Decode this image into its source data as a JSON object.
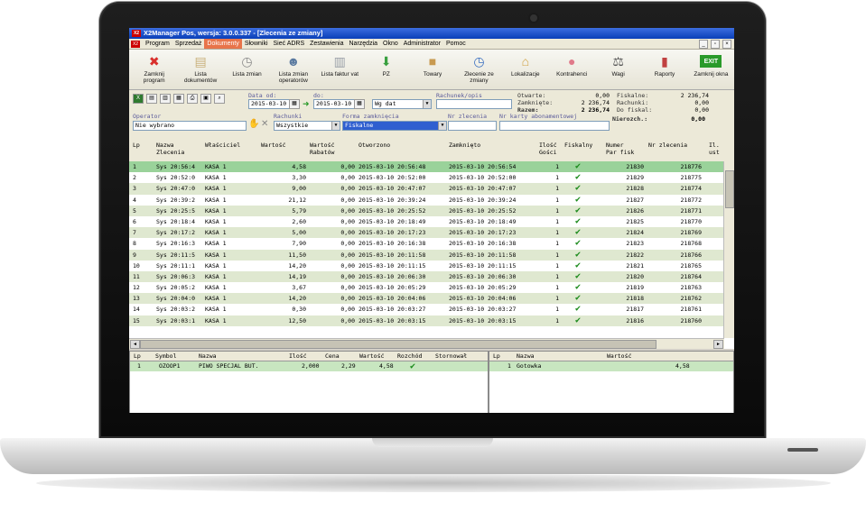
{
  "window": {
    "title": "X2Manager Pos, wersja: 3.0.0.337 - [Zlecenia ze zmiany]",
    "app_icon_text": "X2"
  },
  "menu": [
    "Program",
    "Sprzedaż",
    "Dokumenty",
    "Słowniki",
    "Sieć ADRS",
    "Zestawienia",
    "Narzędzia",
    "Okno",
    "Administrator",
    "Pomoc"
  ],
  "menu_active": "Dokumenty",
  "toolbar": [
    {
      "label": "Zamknij\nprogram",
      "icon": "close-icon",
      "color": "#d9302c"
    },
    {
      "label": "Lista\ndokumentów",
      "icon": "documents-icon",
      "color": "#c8b07a"
    },
    {
      "label": "Lista zmian",
      "icon": "clock-icon",
      "color": "#8a8a8a"
    },
    {
      "label": "Lista zmian\noperatorów",
      "icon": "users-icon",
      "color": "#5a7aa0"
    },
    {
      "label": "Lista faktur vat",
      "icon": "invoice-icon",
      "color": "#9aa0a8"
    },
    {
      "label": "PZ",
      "icon": "pz-icon",
      "color": "#3aa040"
    },
    {
      "label": "Towary",
      "icon": "box-icon",
      "color": "#c89a50"
    },
    {
      "label": "Zlecenie ze\nzmiany",
      "icon": "clock-blue-icon",
      "color": "#3a6fc0"
    },
    {
      "label": "Lokalizacje",
      "icon": "house-icon",
      "color": "#d0a040"
    },
    {
      "label": "Kontrahenci",
      "icon": "piggy-icon",
      "color": "#e07a8a"
    },
    {
      "label": "Wagi",
      "icon": "scale-icon",
      "color": "#555555"
    },
    {
      "label": "Raporty",
      "icon": "chart-icon",
      "color": "#c04040"
    },
    {
      "label": "Zamknij okna",
      "icon": "exit-icon",
      "color": "#2a9a2a",
      "text": "EXIT"
    }
  ],
  "filters": {
    "data_od_label": "Data od:",
    "data_od": "2015-03-10",
    "do_label": "do:",
    "do": "2015-03-10",
    "wg_dat": "Wg dat",
    "rachunek_opis_label": "Rachunek/opis",
    "operator_label": "Operator",
    "operator_value": "Nie wybrano",
    "rachunki_label": "Rachunki",
    "rachunki_value": "Wszystkie",
    "forma_label": "Forma zamknięcia",
    "forma_value": "Fiskalne",
    "nr_zlecenia_label": "Nr zlecenia",
    "nr_karty_label": "Nr karty abonamentowej"
  },
  "summary": {
    "otwarte_label": "Otwarte:",
    "otwarte": "0,00",
    "zamkniete_label": "Zamknięte:",
    "zamkniete": "2 236,74",
    "razem_label": "Razem:",
    "razem": "2 236,74",
    "fiskalne_label": "Fiskalne:",
    "fiskalne": "2 236,74",
    "rachunki_label": "Rachunki:",
    "rachunki": "0,00",
    "do_fiskal_label": "Do fiskal:",
    "do_fiskal": "0,00",
    "nierozch_label": "Nierozch.:",
    "nierozch": "0,00"
  },
  "grid": {
    "headers": {
      "lp": "Lp",
      "nazwa": "Nazwa\nZlecenia",
      "wlasciciel": "Właściciel",
      "wartosc": "Wartość",
      "rabat": "Wartość\nRabatów",
      "otworzono": "Otworzono",
      "zamknieto": "Zamknięto",
      "ilosc": "Ilość\nGości",
      "fiskalny": "Fiskalny",
      "numer": "Numer\nPar fisk",
      "nr": "Nr zlecenia",
      "il": "Il.\nust"
    },
    "rows": [
      {
        "lp": "1",
        "nazwa": "Sys 20:56:4",
        "wl": "KASA 1",
        "wart": "4,58",
        "rab": "0,00",
        "otw": "2015-03-10 20:56:48",
        "zam": "2015-03-10 20:56:54",
        "il": "1",
        "par": "21830",
        "nr": "218776"
      },
      {
        "lp": "2",
        "nazwa": "Sys 20:52:0",
        "wl": "KASA 1",
        "wart": "3,30",
        "rab": "0,00",
        "otw": "2015-03-10 20:52:00",
        "zam": "2015-03-10 20:52:00",
        "il": "1",
        "par": "21829",
        "nr": "218775"
      },
      {
        "lp": "3",
        "nazwa": "Sys 20:47:0",
        "wl": "KASA 1",
        "wart": "9,00",
        "rab": "0,00",
        "otw": "2015-03-10 20:47:07",
        "zam": "2015-03-10 20:47:07",
        "il": "1",
        "par": "21828",
        "nr": "218774"
      },
      {
        "lp": "4",
        "nazwa": "Sys 20:39:2",
        "wl": "KASA 1",
        "wart": "21,12",
        "rab": "0,00",
        "otw": "2015-03-10 20:39:24",
        "zam": "2015-03-10 20:39:24",
        "il": "1",
        "par": "21827",
        "nr": "218772"
      },
      {
        "lp": "5",
        "nazwa": "Sys 20:25:5",
        "wl": "KASA 1",
        "wart": "5,79",
        "rab": "0,00",
        "otw": "2015-03-10 20:25:52",
        "zam": "2015-03-10 20:25:52",
        "il": "1",
        "par": "21826",
        "nr": "218771"
      },
      {
        "lp": "6",
        "nazwa": "Sys 20:18:4",
        "wl": "KASA 1",
        "wart": "2,60",
        "rab": "0,00",
        "otw": "2015-03-10 20:18:49",
        "zam": "2015-03-10 20:18:49",
        "il": "1",
        "par": "21825",
        "nr": "218770"
      },
      {
        "lp": "7",
        "nazwa": "Sys 20:17:2",
        "wl": "KASA 1",
        "wart": "5,00",
        "rab": "0,00",
        "otw": "2015-03-10 20:17:23",
        "zam": "2015-03-10 20:17:23",
        "il": "1",
        "par": "21824",
        "nr": "218769"
      },
      {
        "lp": "8",
        "nazwa": "Sys 20:16:3",
        "wl": "KASA 1",
        "wart": "7,90",
        "rab": "0,00",
        "otw": "2015-03-10 20:16:38",
        "zam": "2015-03-10 20:16:38",
        "il": "1",
        "par": "21823",
        "nr": "218768"
      },
      {
        "lp": "9",
        "nazwa": "Sys 20:11:5",
        "wl": "KASA 1",
        "wart": "11,50",
        "rab": "0,00",
        "otw": "2015-03-10 20:11:58",
        "zam": "2015-03-10 20:11:58",
        "il": "1",
        "par": "21822",
        "nr": "218766"
      },
      {
        "lp": "10",
        "nazwa": "Sys 20:11:1",
        "wl": "KASA 1",
        "wart": "14,20",
        "rab": "0,00",
        "otw": "2015-03-10 20:11:15",
        "zam": "2015-03-10 20:11:15",
        "il": "1",
        "par": "21821",
        "nr": "218765"
      },
      {
        "lp": "11",
        "nazwa": "Sys 20:06:3",
        "wl": "KASA 1",
        "wart": "14,19",
        "rab": "0,00",
        "otw": "2015-03-10 20:06:30",
        "zam": "2015-03-10 20:06:30",
        "il": "1",
        "par": "21820",
        "nr": "218764"
      },
      {
        "lp": "12",
        "nazwa": "Sys 20:05:2",
        "wl": "KASA 1",
        "wart": "3,67",
        "rab": "0,00",
        "otw": "2015-03-10 20:05:29",
        "zam": "2015-03-10 20:05:29",
        "il": "1",
        "par": "21819",
        "nr": "218763"
      },
      {
        "lp": "13",
        "nazwa": "Sys 20:04:0",
        "wl": "KASA 1",
        "wart": "14,20",
        "rab": "0,00",
        "otw": "2015-03-10 20:04:06",
        "zam": "2015-03-10 20:04:06",
        "il": "1",
        "par": "21818",
        "nr": "218762"
      },
      {
        "lp": "14",
        "nazwa": "Sys 20:03:2",
        "wl": "KASA 1",
        "wart": "0,30",
        "rab": "0,00",
        "otw": "2015-03-10 20:03:27",
        "zam": "2015-03-10 20:03:27",
        "il": "1",
        "par": "21817",
        "nr": "218761"
      },
      {
        "lp": "15",
        "nazwa": "Sys 20:03:1",
        "wl": "KASA 1",
        "wart": "12,50",
        "rab": "0,00",
        "otw": "2015-03-10 20:03:15",
        "zam": "2015-03-10 20:03:15",
        "il": "1",
        "par": "21816",
        "nr": "218760"
      }
    ]
  },
  "items_panel": {
    "headers": {
      "lp": "Lp",
      "symbol": "Symbol",
      "nazwa": "Nazwa",
      "ilosc": "Ilość",
      "cena": "Cena",
      "wartosc": "Wartość",
      "rozchod": "Rozchód",
      "stornowal": "Stornował"
    },
    "rows": [
      {
        "lp": "1",
        "symbol": "OZOOP1",
        "nazwa": "PIWO SPECJAL BUT.",
        "ilosc": "2,000",
        "cena": "2,29",
        "wartosc": "4,58"
      }
    ]
  },
  "payments_panel": {
    "headers": {
      "lp": "Lp",
      "nazwa": "Nazwa",
      "wartosc": "Wartość"
    },
    "rows": [
      {
        "lp": "1",
        "nazwa": "Gotowka",
        "wartosc": "4,58"
      }
    ]
  }
}
